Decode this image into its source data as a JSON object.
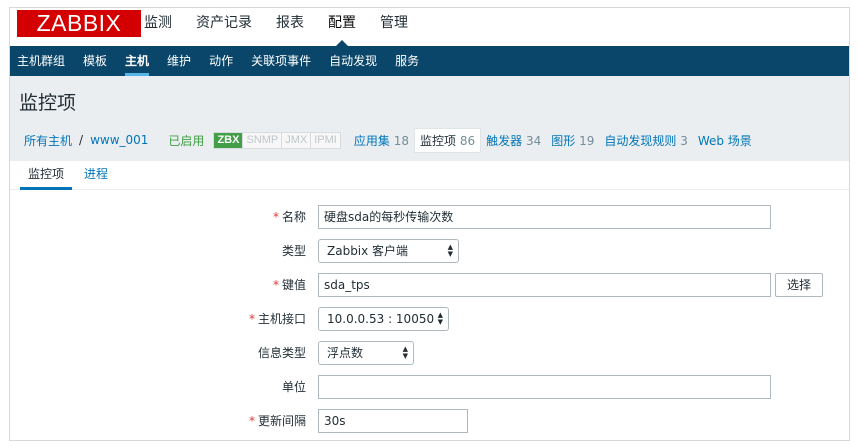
{
  "logo": {
    "text": "ZABBIX"
  },
  "top_menu": [
    "监测",
    "资产记录",
    "报表",
    "配置",
    "管理"
  ],
  "sub_nav": [
    "主机群组",
    "模板",
    "主机",
    "维护",
    "动作",
    "关联项事件",
    "自动发现",
    "服务"
  ],
  "page_title": "监控项",
  "host_nav": {
    "all_hosts": "所有主机",
    "separator": "/",
    "host_name": "www_001",
    "status": "已启用",
    "availability": [
      "ZBX",
      "SNMP",
      "JMX",
      "IPMI"
    ],
    "applications": {
      "label": "应用集",
      "count": "18"
    },
    "items": {
      "label": "监控项",
      "count": "86"
    },
    "triggers": {
      "label": "触发器",
      "count": "34"
    },
    "graphs": {
      "label": "图形",
      "count": "19"
    },
    "discovery": {
      "label": "自动发现规则",
      "count": "3"
    },
    "web": {
      "label": "Web 场景"
    }
  },
  "tabs": [
    "监控项",
    "进程"
  ],
  "form": {
    "required_mark": "*",
    "name": {
      "label": "名称",
      "value": "硬盘sda的每秒传输次数"
    },
    "type": {
      "label": "类型",
      "value": "Zabbix 客户端"
    },
    "key": {
      "label": "键值",
      "value": "sda_tps",
      "button": "选择"
    },
    "interface": {
      "label": "主机接口",
      "value": "10.0.0.53 : 10050"
    },
    "info_type": {
      "label": "信息类型",
      "value": "浮点数"
    },
    "units": {
      "label": "单位",
      "value": ""
    },
    "interval": {
      "label": "更新间隔",
      "value": "30s"
    }
  },
  "colors": {
    "logo_red": "#d40000",
    "nav_blue": "#0a466a",
    "link_blue": "#0275b8",
    "enabled_green": "#429e47",
    "required_red": "#e33734"
  }
}
